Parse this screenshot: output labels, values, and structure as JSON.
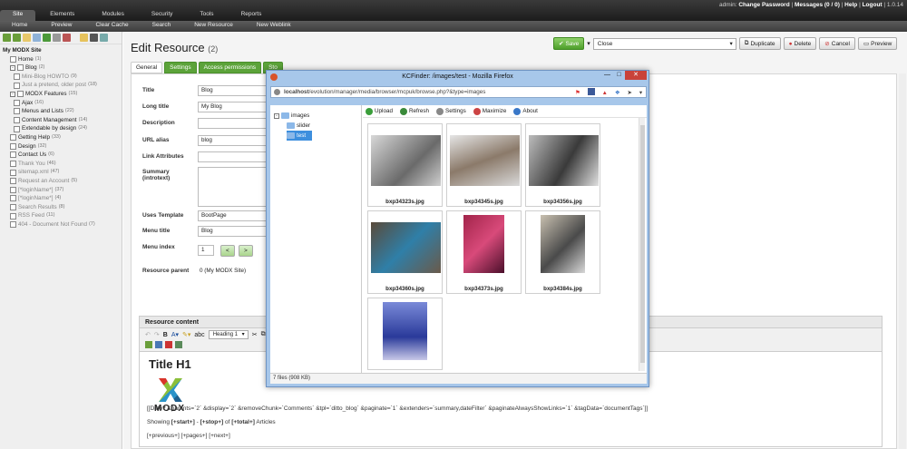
{
  "topbar": {
    "nav": [
      "Site",
      "Elements",
      "Modules",
      "Security",
      "Tools",
      "Reports"
    ],
    "user": "admin:",
    "change_password": "Change Password",
    "messages": "Messages (0 / 0)",
    "help": "Help",
    "logout": "Logout",
    "version": "1.0.14"
  },
  "subbar": [
    "Home",
    "Preview",
    "Clear Cache",
    "Search",
    "New Resource",
    "New Weblink"
  ],
  "tree": [
    {
      "label": "My MODX Site",
      "count": "",
      "bold": true,
      "exp": ""
    },
    {
      "label": "Home",
      "count": "(1)",
      "exp": ""
    },
    {
      "label": "Blog",
      "count": "(2)",
      "exp": "-"
    },
    {
      "label": "Mini-Blog HOWTO",
      "count": "(9)",
      "dim": true,
      "indent": 2
    },
    {
      "label": "Just a pretend, older post",
      "count": "(18)",
      "dim": true,
      "indent": 2
    },
    {
      "label": "MODX Features",
      "count": "(15)",
      "exp": "-"
    },
    {
      "label": "Ajax",
      "count": "(16)",
      "indent": 2
    },
    {
      "label": "Menus and Lists",
      "count": "(22)",
      "indent": 2
    },
    {
      "label": "Content Management",
      "count": "(14)",
      "indent": 2
    },
    {
      "label": "Extendable by design",
      "count": "(24)",
      "indent": 2
    },
    {
      "label": "Getting Help",
      "count": "(33)"
    },
    {
      "label": "Design",
      "count": "(32)"
    },
    {
      "label": "Contact Us",
      "count": "(6)"
    },
    {
      "label": "Thank You",
      "count": "(46)",
      "dim": true
    },
    {
      "label": "sitemap.xml",
      "count": "(47)",
      "dim": true
    },
    {
      "label": "Request an Account",
      "count": "(5)",
      "dim": true
    },
    {
      "label": "[*loginName*]",
      "count": "(37)",
      "dim": true
    },
    {
      "label": "[*loginName*]",
      "count": "(4)",
      "dim": true
    },
    {
      "label": "Search Results",
      "count": "(8)",
      "dim": true
    },
    {
      "label": "RSS Feed",
      "count": "(11)",
      "dim": true
    },
    {
      "label": "404 - Document Not Found",
      "count": "(7)",
      "dim": true
    }
  ],
  "main": {
    "title": "Edit Resource",
    "title_count": "(2)",
    "save": "Save",
    "action_select": "Close",
    "duplicate": "Duplicate",
    "delete": "Delete",
    "cancel": "Cancel",
    "preview": "Preview",
    "tabs": [
      "General",
      "Settings",
      "Access permissions",
      "Sto"
    ],
    "fields": [
      {
        "label": "Title",
        "value": "Blog"
      },
      {
        "label": "Long title",
        "value": "My Blog"
      },
      {
        "label": "Description",
        "value": ""
      },
      {
        "label": "URL alias",
        "value": "blog"
      },
      {
        "label": "Link Attributes",
        "value": ""
      },
      {
        "label": "Summary (introtext)",
        "value": ""
      },
      {
        "label": "Uses Template",
        "value": "BootPage"
      },
      {
        "label": "Menu title",
        "value": "Blog"
      },
      {
        "label": "Menu index",
        "value": "1"
      }
    ],
    "resource_parent_label": "Resource parent",
    "resource_parent_value": "0 (My MODX Site)",
    "content_header": "Resource content",
    "format_select": "Heading 1",
    "h1": "Title H1",
    "logo_text": "MODX",
    "ditto": "[[Ditto? &parents=`2` &display=`2` &removeChunk=`Comments` &tpl=`ditto_blog` &paginate=`1` &extenders=`summary,dateFilter` &paginateAlwaysShowLinks=`1` &tagData=`documentTags`]]",
    "showing_prefix": "Showing",
    "showing_start": "[+start+]",
    "showing_dash": "-",
    "showing_stop": "[+stop+]",
    "showing_of": "of",
    "showing_total": "[+total+]",
    "showing_suffix": "Articles",
    "pager": "[+previous+] [+pages+] [+next+]"
  },
  "kcfinder": {
    "title": "KCFinder: /images/test - Mozilla Firefox",
    "url_host": "localhost",
    "url_path": "/evolution/manager/media/browser/mcpuk/browse.php?&type=images",
    "tree": [
      {
        "label": "images",
        "exp": "-"
      },
      {
        "label": "slider"
      },
      {
        "label": "test",
        "selected": true
      }
    ],
    "toolbar": [
      "Upload",
      "Refresh",
      "Settings",
      "Maximize",
      "About"
    ],
    "files": [
      "bxp34323s.jpg",
      "bxp34345s.jpg",
      "bxp34356s.jpg",
      "bxp34360s.jpg",
      "bxp34373s.jpg",
      "bxp34384s.jpg",
      ""
    ],
    "status": "7 files (908 KB)"
  },
  "colors": {
    "save_green": "#5ca33a",
    "topbar": "#2a2a2a",
    "selected_blue": "#3d8fde"
  }
}
